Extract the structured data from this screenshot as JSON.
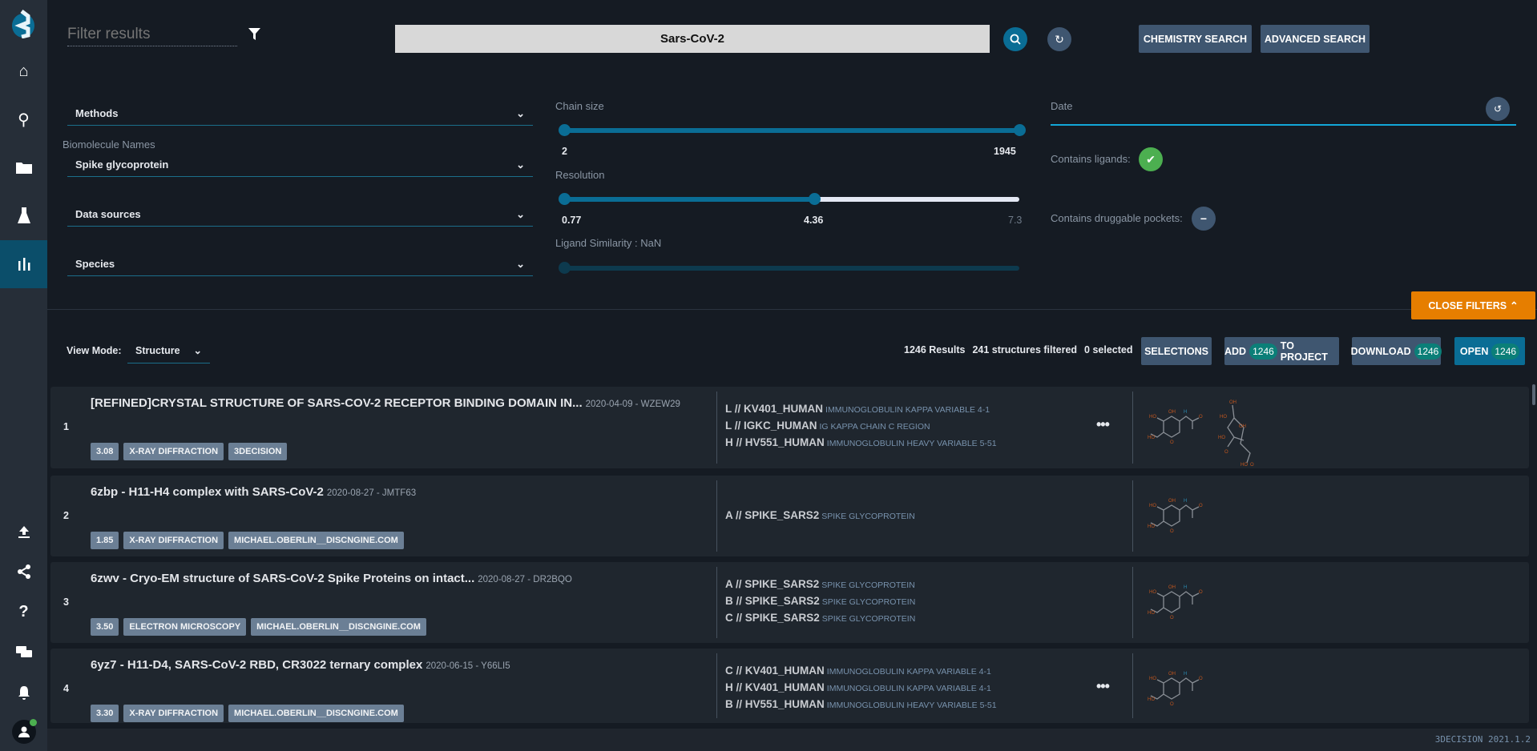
{
  "sidebar": {
    "items": [
      "home-icon",
      "search-icon",
      "folder-icon",
      "flask-icon",
      "chart-icon",
      "upload-icon",
      "share-icon",
      "help-icon",
      "chat-icon",
      "bell-icon",
      "user-icon"
    ],
    "active": "chart-icon"
  },
  "header": {
    "filter_placeholder": "Filter results",
    "search_value": "Sars-CoV-2",
    "chemistry_search": "CHEMISTRY SEARCH",
    "advanced_search": "ADVANCED SEARCH"
  },
  "filters": {
    "methods": "Methods",
    "biomolecule_label": "Biomolecule Names",
    "biomolecule_value": "Spike glycoprotein",
    "data_sources": "Data sources",
    "species": "Species",
    "chain_size": {
      "label": "Chain size",
      "min": "2",
      "max": "1945",
      "low": 2,
      "high": 1945
    },
    "resolution": {
      "label": "Resolution",
      "min": "0.77",
      "value": "4.36",
      "max": "7.3"
    },
    "ligand_similarity": {
      "label": "Ligand Similarity : NaN"
    },
    "date": {
      "label": "Date"
    },
    "contains_ligands": {
      "label": "Contains ligands:",
      "state": "yes"
    },
    "druggable": {
      "label": "Contains druggable pockets:",
      "state": "neutral"
    },
    "close_filters": "CLOSE FILTERS"
  },
  "toolbar": {
    "view_mode_label": "View Mode:",
    "view_mode_value": "Structure",
    "results": "1246 Results",
    "filtered": "241 structures filtered",
    "selected": "0 selected",
    "selections": "SELECTIONS",
    "add": "ADD",
    "add_count": "1246",
    "to_project": "TO PROJECT",
    "download": "DOWNLOAD",
    "download_count": "1246",
    "open": "OPEN",
    "open_count": "1246"
  },
  "results": [
    {
      "num": "1",
      "title": "[REFINED]CRYSTAL STRUCTURE OF SARS-COV-2 RECEPTOR BINDING DOMAIN IN...",
      "meta": "2020-04-09 - WZEW29",
      "tags": [
        "3.08",
        "X-RAY DIFFRACTION",
        "3DECISION"
      ],
      "chains": [
        {
          "id": "L // KV401_HUMAN",
          "desc": "IMMUNOGLOBULIN KAPPA VARIABLE 4-1"
        },
        {
          "id": "L // IGKC_HUMAN",
          "desc": "IG KAPPA CHAIN C REGION"
        },
        {
          "id": "H // HV551_HUMAN",
          "desc": "IMMUNOGLOBULIN HEAVY VARIABLE 5-51"
        }
      ],
      "more": true,
      "ligands": 2
    },
    {
      "num": "2",
      "title": "6zbp - H11-H4 complex with SARS-CoV-2",
      "meta": "2020-08-27 - JMTF63",
      "tags": [
        "1.85",
        "X-RAY DIFFRACTION",
        "MICHAEL.OBERLIN__DISCNGINE.COM"
      ],
      "chains": [
        {
          "id": "A // SPIKE_SARS2",
          "desc": "SPIKE GLYCOPROTEIN"
        }
      ],
      "more": false,
      "ligands": 1
    },
    {
      "num": "3",
      "title": "6zwv - Cryo-EM structure of SARS-CoV-2 Spike Proteins on intact...",
      "meta": "2020-08-27 - DR2BQO",
      "tags": [
        "3.50",
        "ELECTRON MICROSCOPY",
        "MICHAEL.OBERLIN__DISCNGINE.COM"
      ],
      "chains": [
        {
          "id": "A // SPIKE_SARS2",
          "desc": "SPIKE GLYCOPROTEIN"
        },
        {
          "id": "B // SPIKE_SARS2",
          "desc": "SPIKE GLYCOPROTEIN"
        },
        {
          "id": "C // SPIKE_SARS2",
          "desc": "SPIKE GLYCOPROTEIN"
        }
      ],
      "more": false,
      "ligands": 1
    },
    {
      "num": "4",
      "title": "6yz7 - H11-D4, SARS-CoV-2 RBD, CR3022 ternary complex",
      "meta": "2020-06-15 - Y66LI5",
      "tags": [
        "3.30",
        "X-RAY DIFFRACTION",
        "MICHAEL.OBERLIN__DISCNGINE.COM"
      ],
      "chains": [
        {
          "id": "C // KV401_HUMAN",
          "desc": "IMMUNOGLOBULIN KAPPA VARIABLE 4-1"
        },
        {
          "id": "H // KV401_HUMAN",
          "desc": "IMMUNOGLOBULIN KAPPA VARIABLE 4-1"
        },
        {
          "id": "B // HV551_HUMAN",
          "desc": "IMMUNOGLOBULIN HEAVY VARIABLE 5-51"
        }
      ],
      "more": true,
      "ligands": 1
    }
  ],
  "footer": {
    "version": "3DECISION 2021.1.2"
  },
  "colors": {
    "accent": "#0a6d95",
    "orange": "#e67e00",
    "green": "#4caf50",
    "button": "#3f5670"
  }
}
